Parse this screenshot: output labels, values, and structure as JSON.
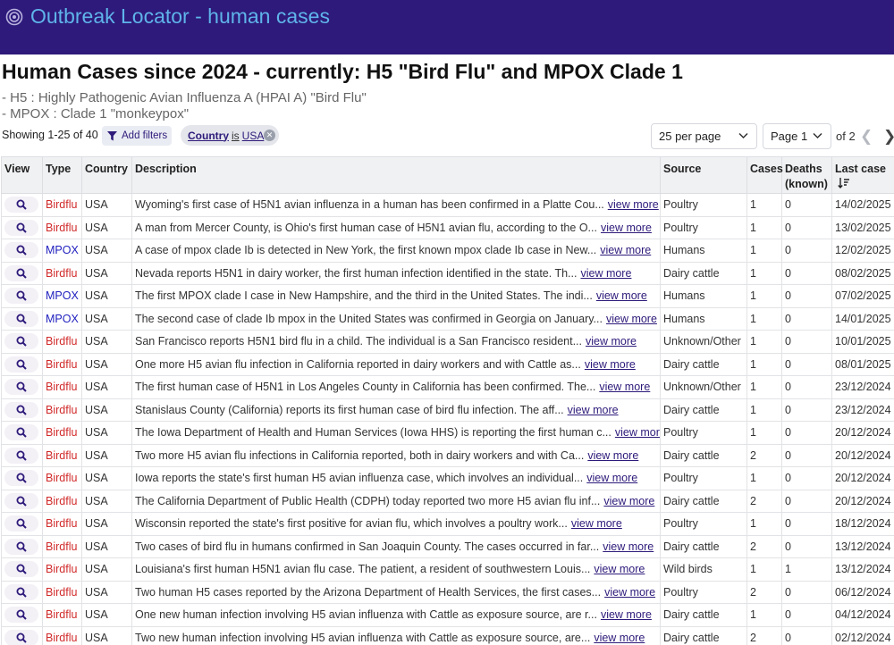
{
  "app": {
    "title": "Outbreak Locator - human cases",
    "logo_icon": "target-icon"
  },
  "page": {
    "title": "Human Cases since 2024 - currently: H5 \"Bird Flu\" and MPOX Clade 1",
    "subtitle_1": "- H5 : Highly Pathogenic Avian Influenza A (HPAI A) \"Bird Flu\"",
    "subtitle_2": "- MPOX : Clade 1 \"monkeypox\""
  },
  "toolbar": {
    "showing": "Showing 1-25 of 40",
    "add_filters": "Add filters",
    "filter_chip": {
      "key": "Country",
      "op": "is",
      "value": "USA"
    },
    "per_page": "25 per page",
    "page": "Page 1",
    "of_pages": "of 2"
  },
  "table": {
    "headers": {
      "view": "View",
      "type": "Type",
      "country": "Country",
      "description": "Description",
      "source": "Source",
      "cases": "Cases",
      "deaths": "Deaths (known)",
      "last_case": "Last case"
    },
    "view_more_label": "view more",
    "rows": [
      {
        "type": "Birdflu",
        "country": "USA",
        "desc": "Wyoming's first case of H5N1 avian influenza in a human has been confirmed in a Platte Cou...",
        "source": "Poultry",
        "cases": "1",
        "deaths": "0",
        "date": "14/02/2025"
      },
      {
        "type": "Birdflu",
        "country": "USA",
        "desc": "A man from Mercer County, is Ohio's first human case of H5N1 avian flu, according to the O...",
        "source": "Poultry",
        "cases": "1",
        "deaths": "0",
        "date": "13/02/2025"
      },
      {
        "type": "MPOX",
        "country": "USA",
        "desc": "A case of mpox clade Ib is detected in New York, the first known mpox clade Ib case in New...",
        "source": "Humans",
        "cases": "1",
        "deaths": "0",
        "date": "12/02/2025"
      },
      {
        "type": "Birdflu",
        "country": "USA",
        "desc": "Nevada reports H5N1 in dairy worker, the first human infection identified in the state. Th...",
        "source": "Dairy cattle",
        "cases": "1",
        "deaths": "0",
        "date": "08/02/2025"
      },
      {
        "type": "MPOX",
        "country": "USA",
        "desc": "The first MPOX clade I case in New Hampshire, and the third in the United States. The indi...",
        "source": "Humans",
        "cases": "1",
        "deaths": "0",
        "date": "07/02/2025"
      },
      {
        "type": "MPOX",
        "country": "USA",
        "desc": "The second case of clade Ib mpox in the United States was confirmed in Georgia on January...",
        "source": "Humans",
        "cases": "1",
        "deaths": "0",
        "date": "14/01/2025"
      },
      {
        "type": "Birdflu",
        "country": "USA",
        "desc": "San Francisco reports H5N1 bird flu in a child. The individual is a San Francisco resident...",
        "source": "Unknown/Other",
        "cases": "1",
        "deaths": "0",
        "date": "10/01/2025"
      },
      {
        "type": "Birdflu",
        "country": "USA",
        "desc": "One more H5 avian flu infection in California reported in dairy workers and with Cattle as...",
        "source": "Dairy cattle",
        "cases": "1",
        "deaths": "0",
        "date": "08/01/2025"
      },
      {
        "type": "Birdflu",
        "country": "USA",
        "desc": "The first human case of H5N1 in Los Angeles County in California has been confirmed. The...",
        "source": "Unknown/Other",
        "cases": "1",
        "deaths": "0",
        "date": "23/12/2024"
      },
      {
        "type": "Birdflu",
        "country": "USA",
        "desc": "Stanislaus County (California) reports its first human case of bird flu infection. The aff...",
        "source": "Dairy cattle",
        "cases": "1",
        "deaths": "0",
        "date": "23/12/2024"
      },
      {
        "type": "Birdflu",
        "country": "USA",
        "desc": "The Iowa Department of Health and Human Services (Iowa HHS) is reporting the first human c...",
        "source": "Poultry",
        "cases": "1",
        "deaths": "0",
        "date": "20/12/2024"
      },
      {
        "type": "Birdflu",
        "country": "USA",
        "desc": "Two more H5 avian flu infections in California reported, both in dairy workers and with Ca...",
        "source": "Dairy cattle",
        "cases": "2",
        "deaths": "0",
        "date": "20/12/2024"
      },
      {
        "type": "Birdflu",
        "country": "USA",
        "desc": "Iowa reports the state's first human H5 avian influenza case, which involves an individual...",
        "source": "Poultry",
        "cases": "1",
        "deaths": "0",
        "date": "20/12/2024"
      },
      {
        "type": "Birdflu",
        "country": "USA",
        "desc": "The California Department of Public Health (CDPH) today reported two more H5 avian flu inf...",
        "source": "Dairy cattle",
        "cases": "2",
        "deaths": "0",
        "date": "20/12/2024"
      },
      {
        "type": "Birdflu",
        "country": "USA",
        "desc": "Wisconsin reported the state's first positive for avian flu, which involves a poultry work...",
        "source": "Poultry",
        "cases": "1",
        "deaths": "0",
        "date": "18/12/2024"
      },
      {
        "type": "Birdflu",
        "country": "USA",
        "desc": "Two cases of bird flu in humans confirmed in San Joaquin County. The cases occurred in far...",
        "source": "Dairy cattle",
        "cases": "2",
        "deaths": "0",
        "date": "13/12/2024"
      },
      {
        "type": "Birdflu",
        "country": "USA",
        "desc": "Louisiana's first human H5N1 avian flu case. The patient, a resident of southwestern Louis...",
        "source": "Wild birds",
        "cases": "1",
        "deaths": "1",
        "date": "13/12/2024"
      },
      {
        "type": "Birdflu",
        "country": "USA",
        "desc": "Two human H5 cases reported by the Arizona Department of Health Services, the first cases...",
        "source": "Poultry",
        "cases": "2",
        "deaths": "0",
        "date": "06/12/2024"
      },
      {
        "type": "Birdflu",
        "country": "USA",
        "desc": "One new human infection involving H5 avian influenza with Cattle as exposure source, are r...",
        "source": "Dairy cattle",
        "cases": "1",
        "deaths": "0",
        "date": "04/12/2024"
      },
      {
        "type": "Birdflu",
        "country": "USA",
        "desc": "Two new human infection involving H5 avian influenza with Cattle as exposure source, are...",
        "source": "Dairy cattle",
        "cases": "2",
        "deaths": "0",
        "date": "02/12/2024"
      }
    ]
  },
  "colors": {
    "header_bg": "#2e1a7a",
    "app_title": "#5fb4ea",
    "birdflu": "#d12a2a",
    "mpox": "#1f1fbf",
    "link": "#2e1a7a"
  }
}
